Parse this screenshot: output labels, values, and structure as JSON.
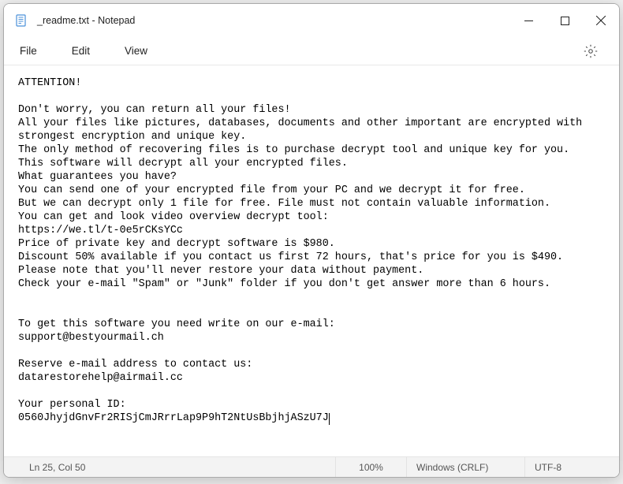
{
  "titlebar": {
    "title": "_readme.txt - Notepad"
  },
  "menubar": {
    "file": "File",
    "edit": "Edit",
    "view": "View"
  },
  "content": {
    "body": "ATTENTION!\n\nDon't worry, you can return all your files!\nAll your files like pictures, databases, documents and other important are encrypted with strongest encryption and unique key.\nThe only method of recovering files is to purchase decrypt tool and unique key for you.\nThis software will decrypt all your encrypted files.\nWhat guarantees you have?\nYou can send one of your encrypted file from your PC and we decrypt it for free.\nBut we can decrypt only 1 file for free. File must not contain valuable information.\nYou can get and look video overview decrypt tool:\nhttps://we.tl/t-0e5rCKsYCc\nPrice of private key and decrypt software is $980.\nDiscount 50% available if you contact us first 72 hours, that's price for you is $490.\nPlease note that you'll never restore your data without payment.\nCheck your e-mail \"Spam\" or \"Junk\" folder if you don't get answer more than 6 hours.\n\n\nTo get this software you need write on our e-mail:\nsupport@bestyourmail.ch\n\nReserve e-mail address to contact us:\ndatarestorehelp@airmail.cc\n\nYour personal ID:",
    "last_line": "0560JhyjdGnvFr2RISjCmJRrrLap9P9hT2NtUsBbjhjASzU7J"
  },
  "statusbar": {
    "position": "Ln 25, Col 50",
    "zoom": "100%",
    "eol": "Windows (CRLF)",
    "encoding": "UTF-8"
  }
}
